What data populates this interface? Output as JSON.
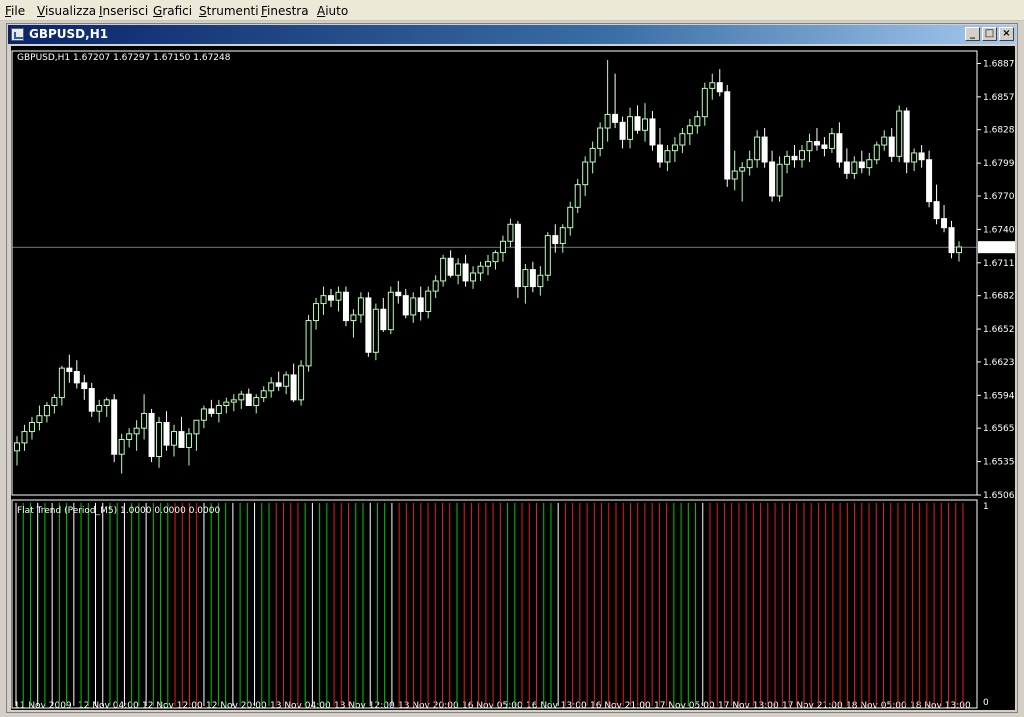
{
  "menu": [
    {
      "label": "File",
      "mnemonic": "F"
    },
    {
      "label": "Visualizza",
      "mnemonic": "V"
    },
    {
      "label": "Inserisci",
      "mnemonic": "I"
    },
    {
      "label": "Grafici",
      "mnemonic": "G"
    },
    {
      "label": "Strumenti",
      "mnemonic": "S"
    },
    {
      "label": "Finestra",
      "mnemonic": "F"
    },
    {
      "label": "Aiuto",
      "mnemonic": "A"
    }
  ],
  "window": {
    "title": "GBPUSD,H1",
    "minimize_icon": "minimize-icon",
    "restore_icon": "restore-icon",
    "close_icon": "close-icon"
  },
  "chart": {
    "header": "GBPUSD,H1  1.67207 1.67297 1.67150 1.67248",
    "indicator_header": "Flat Trend (Period_M5) 1.0000 0.0000 0.0000",
    "current_price": "1.67248",
    "bull_color": "#b6ffb6",
    "bear_color": "#ffffff",
    "background": "#000000",
    "indicator_up_color": "#00c800",
    "indicator_down_color": "#e61e1e",
    "indicator_flat_color": "#ffffff"
  },
  "chart_data": [
    {
      "type": "candlestick",
      "title": "GBPUSD,H1",
      "y_ticks": [
        "1.68870",
        "1.68575",
        "1.68285",
        "1.67990",
        "1.67700",
        "1.67405",
        "1.67110",
        "1.66820",
        "1.66525",
        "1.66235",
        "1.65940",
        "1.65650",
        "1.65355",
        "1.65060"
      ],
      "x_ticks": [
        "11 Nov 2009",
        "12 Nov 04:00",
        "12 Nov 12:00",
        "12 Nov 20:00",
        "13 Nov 04:00",
        "13 Nov 12:00",
        "13 Nov 20:00",
        "16 Nov 05:00",
        "16 Nov 13:00",
        "16 Nov 21:00",
        "17 Nov 05:00",
        "17 Nov 13:00",
        "17 Nov 21:00",
        "18 Nov 05:00",
        "18 Nov 13:00"
      ],
      "ylim": [
        1.6506,
        1.6898
      ],
      "ohlc": [
        [
          1.6545,
          1.6558,
          1.6532,
          1.6552
        ],
        [
          1.6552,
          1.6568,
          1.6545,
          1.6562
        ],
        [
          1.6562,
          1.6575,
          1.6555,
          1.657
        ],
        [
          1.657,
          1.6585,
          1.6563,
          1.6576
        ],
        [
          1.6576,
          1.6588,
          1.657,
          1.6585
        ],
        [
          1.6585,
          1.6595,
          1.6578,
          1.6592
        ],
        [
          1.6592,
          1.662,
          1.6585,
          1.6618
        ],
        [
          1.6618,
          1.663,
          1.6605,
          1.6615
        ],
        [
          1.6615,
          1.6625,
          1.66,
          1.6605
        ],
        [
          1.6605,
          1.6612,
          1.659,
          1.66
        ],
        [
          1.66,
          1.6605,
          1.6575,
          1.658
        ],
        [
          1.658,
          1.659,
          1.657,
          1.6585
        ],
        [
          1.6585,
          1.6592,
          1.6575,
          1.659
        ],
        [
          1.659,
          1.6595,
          1.6535,
          1.6542
        ],
        [
          1.6542,
          1.656,
          1.6525,
          1.6555
        ],
        [
          1.6555,
          1.6565,
          1.6548,
          1.656
        ],
        [
          1.656,
          1.6572,
          1.6545,
          1.6565
        ],
        [
          1.6565,
          1.6595,
          1.6555,
          1.6578
        ],
        [
          1.6578,
          1.6582,
          1.6535,
          1.654
        ],
        [
          1.654,
          1.6575,
          1.653,
          1.657
        ],
        [
          1.657,
          1.658,
          1.6545,
          1.655
        ],
        [
          1.655,
          1.6568,
          1.654,
          1.6562
        ],
        [
          1.6562,
          1.6575,
          1.655,
          1.6548
        ],
        [
          1.6548,
          1.6565,
          1.6532,
          1.656
        ],
        [
          1.656,
          1.657,
          1.6545,
          1.6572
        ],
        [
          1.6572,
          1.6585,
          1.6565,
          1.6582
        ],
        [
          1.6582,
          1.659,
          1.6575,
          1.6578
        ],
        [
          1.6578,
          1.659,
          1.657,
          1.6585
        ],
        [
          1.6585,
          1.6592,
          1.6578,
          1.6588
        ],
        [
          1.6588,
          1.6595,
          1.658,
          1.659
        ],
        [
          1.659,
          1.6598,
          1.6582,
          1.6595
        ],
        [
          1.6595,
          1.66,
          1.6585,
          1.6585
        ],
        [
          1.6585,
          1.6595,
          1.6578,
          1.6592
        ],
        [
          1.6592,
          1.6602,
          1.6588,
          1.6598
        ],
        [
          1.6598,
          1.661,
          1.6592,
          1.6605
        ],
        [
          1.6605,
          1.6615,
          1.6598,
          1.6602
        ],
        [
          1.6602,
          1.6615,
          1.6595,
          1.6612
        ],
        [
          1.6612,
          1.6622,
          1.6588,
          1.659
        ],
        [
          1.659,
          1.6625,
          1.6585,
          1.662
        ],
        [
          1.662,
          1.6665,
          1.6615,
          1.666
        ],
        [
          1.666,
          1.668,
          1.6652,
          1.6675
        ],
        [
          1.6675,
          1.669,
          1.6665,
          1.6682
        ],
        [
          1.6682,
          1.6688,
          1.6672,
          1.6678
        ],
        [
          1.6678,
          1.669,
          1.6668,
          1.6685
        ],
        [
          1.6685,
          1.669,
          1.6655,
          1.666
        ],
        [
          1.666,
          1.667,
          1.6645,
          1.6665
        ],
        [
          1.6665,
          1.6685,
          1.6658,
          1.668
        ],
        [
          1.668,
          1.6685,
          1.6628,
          1.6632
        ],
        [
          1.6632,
          1.6675,
          1.6625,
          1.667
        ],
        [
          1.667,
          1.668,
          1.665,
          1.6652
        ],
        [
          1.6652,
          1.669,
          1.6648,
          1.6685
        ],
        [
          1.6685,
          1.6695,
          1.6675,
          1.6682
        ],
        [
          1.6682,
          1.6688,
          1.6662,
          1.6665
        ],
        [
          1.6665,
          1.6685,
          1.6658,
          1.668
        ],
        [
          1.668,
          1.669,
          1.666,
          1.6668
        ],
        [
          1.6668,
          1.669,
          1.6662,
          1.6686
        ],
        [
          1.6686,
          1.67,
          1.668,
          1.6695
        ],
        [
          1.6695,
          1.6718,
          1.669,
          1.6715
        ],
        [
          1.6715,
          1.6722,
          1.6698,
          1.67
        ],
        [
          1.67,
          1.6715,
          1.6692,
          1.671
        ],
        [
          1.671,
          1.6718,
          1.669,
          1.6695
        ],
        [
          1.6695,
          1.6708,
          1.6688,
          1.6702
        ],
        [
          1.6702,
          1.6712,
          1.6695,
          1.6708
        ],
        [
          1.6708,
          1.6718,
          1.67,
          1.6712
        ],
        [
          1.6712,
          1.6722,
          1.6705,
          1.672
        ],
        [
          1.672,
          1.6735,
          1.6712,
          1.673
        ],
        [
          1.673,
          1.675,
          1.6725,
          1.6745
        ],
        [
          1.6745,
          1.6748,
          1.668,
          1.669
        ],
        [
          1.669,
          1.671,
          1.6675,
          1.6705
        ],
        [
          1.6705,
          1.6712,
          1.6685,
          1.669
        ],
        [
          1.669,
          1.6708,
          1.6682,
          1.67
        ],
        [
          1.67,
          1.6738,
          1.6695,
          1.6735
        ],
        [
          1.6735,
          1.6745,
          1.672,
          1.6728
        ],
        [
          1.6728,
          1.6745,
          1.672,
          1.6742
        ],
        [
          1.6742,
          1.6765,
          1.6735,
          1.676
        ],
        [
          1.676,
          1.6785,
          1.6755,
          1.678
        ],
        [
          1.678,
          1.6805,
          1.677,
          1.68
        ],
        [
          1.68,
          1.6818,
          1.679,
          1.6812
        ],
        [
          1.6812,
          1.6835,
          1.6805,
          1.683
        ],
        [
          1.683,
          1.689,
          1.6818,
          1.6842
        ],
        [
          1.6842,
          1.6878,
          1.683,
          1.6835
        ],
        [
          1.6835,
          1.684,
          1.6812,
          1.682
        ],
        [
          1.682,
          1.6848,
          1.6812,
          1.684
        ],
        [
          1.684,
          1.685,
          1.6825,
          1.6828
        ],
        [
          1.6828,
          1.6852,
          1.6818,
          1.6838
        ],
        [
          1.6838,
          1.6845,
          1.681,
          1.6815
        ],
        [
          1.6815,
          1.683,
          1.6795,
          1.68
        ],
        [
          1.68,
          1.6815,
          1.6792,
          1.681
        ],
        [
          1.681,
          1.6822,
          1.68,
          1.6815
        ],
        [
          1.6815,
          1.683,
          1.6808,
          1.6825
        ],
        [
          1.6825,
          1.6838,
          1.6815,
          1.6832
        ],
        [
          1.6832,
          1.6845,
          1.6825,
          1.684
        ],
        [
          1.684,
          1.687,
          1.6832,
          1.6865
        ],
        [
          1.6865,
          1.6878,
          1.6855,
          1.687
        ],
        [
          1.687,
          1.6882,
          1.6858,
          1.6862
        ],
        [
          1.6862,
          1.6868,
          1.6778,
          1.6785
        ],
        [
          1.6785,
          1.681,
          1.6775,
          1.6792
        ],
        [
          1.6792,
          1.68,
          1.6765,
          1.6795
        ],
        [
          1.6795,
          1.681,
          1.6788,
          1.6802
        ],
        [
          1.6802,
          1.6828,
          1.6795,
          1.6822
        ],
        [
          1.6822,
          1.683,
          1.6795,
          1.68
        ],
        [
          1.68,
          1.681,
          1.6765,
          1.677
        ],
        [
          1.677,
          1.6805,
          1.6765,
          1.6798
        ],
        [
          1.6798,
          1.681,
          1.679,
          1.6805
        ],
        [
          1.6805,
          1.6815,
          1.6795,
          1.6802
        ],
        [
          1.6802,
          1.6815,
          1.6795,
          1.681
        ],
        [
          1.681,
          1.6825,
          1.68,
          1.6818
        ],
        [
          1.6818,
          1.683,
          1.681,
          1.6815
        ],
        [
          1.6815,
          1.6822,
          1.6805,
          1.6812
        ],
        [
          1.6812,
          1.683,
          1.6808,
          1.6825
        ],
        [
          1.6825,
          1.6835,
          1.6795,
          1.68
        ],
        [
          1.68,
          1.6812,
          1.6785,
          1.679
        ],
        [
          1.679,
          1.6805,
          1.6785,
          1.68
        ],
        [
          1.68,
          1.681,
          1.679,
          1.6795
        ],
        [
          1.6795,
          1.6808,
          1.6788,
          1.6802
        ],
        [
          1.6802,
          1.6818,
          1.6798,
          1.6815
        ],
        [
          1.6815,
          1.6828,
          1.681,
          1.6822
        ],
        [
          1.6822,
          1.683,
          1.68,
          1.6805
        ],
        [
          1.6805,
          1.685,
          1.68,
          1.6845
        ],
        [
          1.6845,
          1.6848,
          1.679,
          1.68
        ],
        [
          1.68,
          1.6812,
          1.6792,
          1.6808
        ],
        [
          1.6808,
          1.6815,
          1.6795,
          1.6802
        ],
        [
          1.6802,
          1.681,
          1.676,
          1.6765
        ],
        [
          1.6765,
          1.678,
          1.6745,
          1.675
        ],
        [
          1.675,
          1.6762,
          1.6738,
          1.6742
        ],
        [
          1.6742,
          1.6748,
          1.6715,
          1.672
        ],
        [
          1.672,
          1.673,
          1.6712,
          1.6725
        ]
      ]
    },
    {
      "type": "bar",
      "title": "Flat Trend (Period_M5) 1.0000 0.0000 0.0000",
      "y_ticks": [
        "1",
        "0"
      ],
      "ylim": [
        0,
        1
      ],
      "states": [
        0,
        1,
        1,
        0,
        1,
        0,
        1,
        1,
        0,
        1,
        1,
        0,
        0,
        1,
        1,
        0,
        1,
        1,
        0,
        1,
        1,
        1,
        -1,
        -1,
        -1,
        -1,
        0,
        1,
        1,
        1,
        0,
        1,
        1,
        0,
        1,
        1,
        -1,
        -1,
        -1,
        -1,
        1,
        0,
        1,
        1,
        -1,
        -1,
        -1,
        1,
        1,
        0,
        1,
        1,
        0,
        -1,
        -1,
        -1,
        -1,
        -1,
        -1,
        -1,
        -1,
        1,
        -1,
        -1,
        -1,
        -1,
        -1,
        -1,
        1,
        1,
        -1,
        -1,
        -1,
        1,
        1,
        0,
        -1,
        -1,
        -1,
        -1,
        -1,
        -1,
        -1,
        -1,
        -1,
        -1,
        -1,
        -1,
        -1,
        -1,
        -1,
        1,
        1,
        1,
        1,
        0,
        -1,
        -1,
        -1,
        -1,
        -1,
        -1,
        -1,
        -1,
        -1,
        -1,
        -1,
        -1,
        -1,
        -1,
        -1,
        -1,
        -1,
        -1,
        -1,
        -1,
        -1,
        -1,
        -1,
        -1,
        -1,
        -1,
        -1,
        -1,
        -1,
        -1,
        -1,
        -1,
        -1,
        -1,
        -1,
        -1
      ]
    }
  ]
}
